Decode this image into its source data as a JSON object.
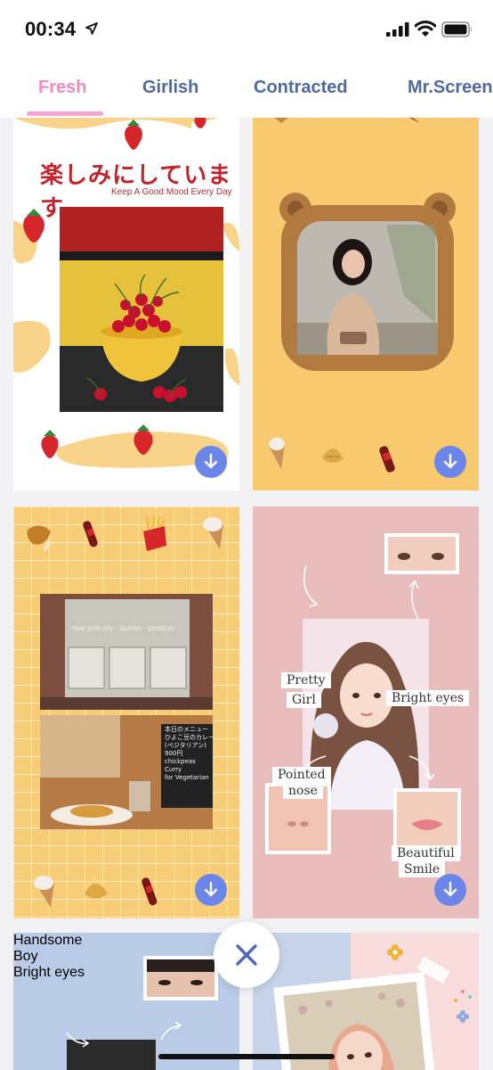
{
  "status_bar": {
    "time": "00:34"
  },
  "tabs": [
    {
      "label": "Fresh",
      "active": true
    },
    {
      "label": "Girlish",
      "active": false
    },
    {
      "label": "Contracted",
      "active": false
    },
    {
      "label": "Mr.Screen",
      "active": false
    }
  ],
  "colors": {
    "active_tab": "#f08cc0",
    "inactive_tab": "#4f6a9e",
    "download_button": "#6b86e8"
  },
  "cards": {
    "card1": {
      "title": "楽しみにしています",
      "subtitle": "Keep A Good Mood Every Day"
    },
    "card3": {
      "menu_lines": [
        "本日のメニュー",
        "ひよこ豆のカレー",
        "(ベジタリアン)",
        "900円",
        "chickpeas Curry",
        "for Vegetarian"
      ],
      "window_text": "new york city · dumbo · brooklyn"
    },
    "card4": {
      "notes": {
        "pretty": "Pretty",
        "girl": "Girl",
        "bright_eyes": "Bright eyes",
        "pointed": "Pointed",
        "nose": "nose",
        "beautiful": "Beautiful",
        "smile": "Smile"
      }
    },
    "card5": {
      "notes": {
        "handsome": "Handsome",
        "boy": "Boy",
        "bright_eyes": "Bright eyes"
      }
    }
  },
  "icons": {
    "download": "down-arrow-circle",
    "close": "close-x",
    "location": "location-arrow",
    "signal": "cellular-bars",
    "wifi": "wifi",
    "battery": "battery"
  }
}
